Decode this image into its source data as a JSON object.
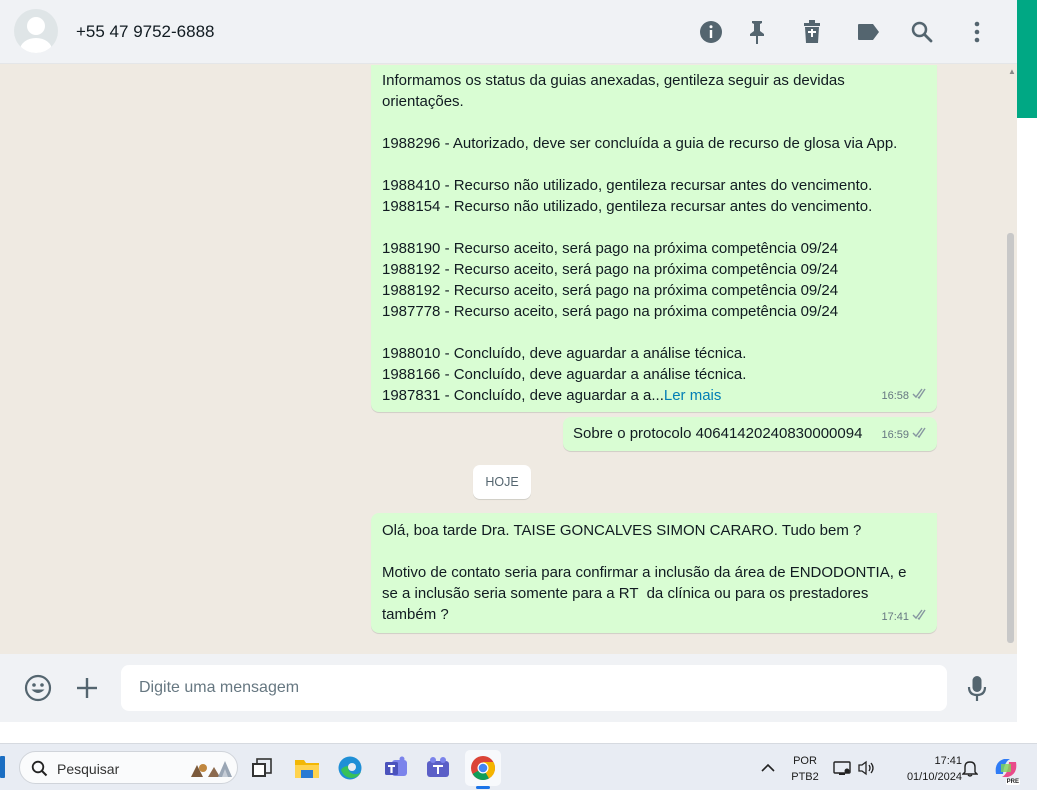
{
  "header": {
    "contact_name": "+55 47 9752-6888",
    "icons": [
      "info-icon",
      "pin-icon",
      "delete-icon",
      "label-icon",
      "search-icon",
      "menu-icon"
    ]
  },
  "messages": [
    {
      "text": "Informamos os status da guias anexadas, gentileza seguir as devidas\norientações.\n\n1988296 - Autorizado, deve ser concluída a guia de recurso de glosa via App.\n\n1988410 - Recurso não utilizado, gentileza recursar antes do vencimento.\n1988154 - Recurso não utilizado, gentileza recursar antes do vencimento.\n\n1988190 - Recurso aceito, será pago na próxima competência 09/24\n1988192 - Recurso aceito, será pago na próxima competência 09/24\n1988192 - Recurso aceito, será pago na próxima competência 09/24\n1987778 - Recurso aceito, será pago na próxima competência 09/24\n\n1988010 - Concluído, deve aguardar a análise técnica.\n1988166 - Concluído, deve aguardar a análise técnica.\n1987831 - Concluído, deve aguardar a a...",
      "read_more": "Ler mais",
      "time": "16:58"
    },
    {
      "text": "Sobre o protocolo 40641420240830000094",
      "time": "16:59"
    },
    {
      "text": "Olá, boa tarde Dra. TAISE GONCALVES SIMON CARARO. Tudo bem ?\n\nMotivo de contato seria para confirmar a inclusão da área de ENDODONTIA, e\nse a inclusão seria somente para a RT  da clínica ou para os prestadores\ntambém ?",
      "time": "17:41"
    }
  ],
  "date_chip": "HOJE",
  "composer": {
    "placeholder": "Digite uma mensagem"
  },
  "taskbar": {
    "search_placeholder": "Pesquisar",
    "lang_top": "POR",
    "lang_bottom": "PTB2",
    "time": "17:41",
    "date": "01/10/2024",
    "copilot_badge": "PRE"
  },
  "colors": {
    "outgoing_bubble": "#d9fdd3",
    "accent": "#00a884",
    "read_ticks": "#8696a0",
    "link": "#027eb5"
  }
}
